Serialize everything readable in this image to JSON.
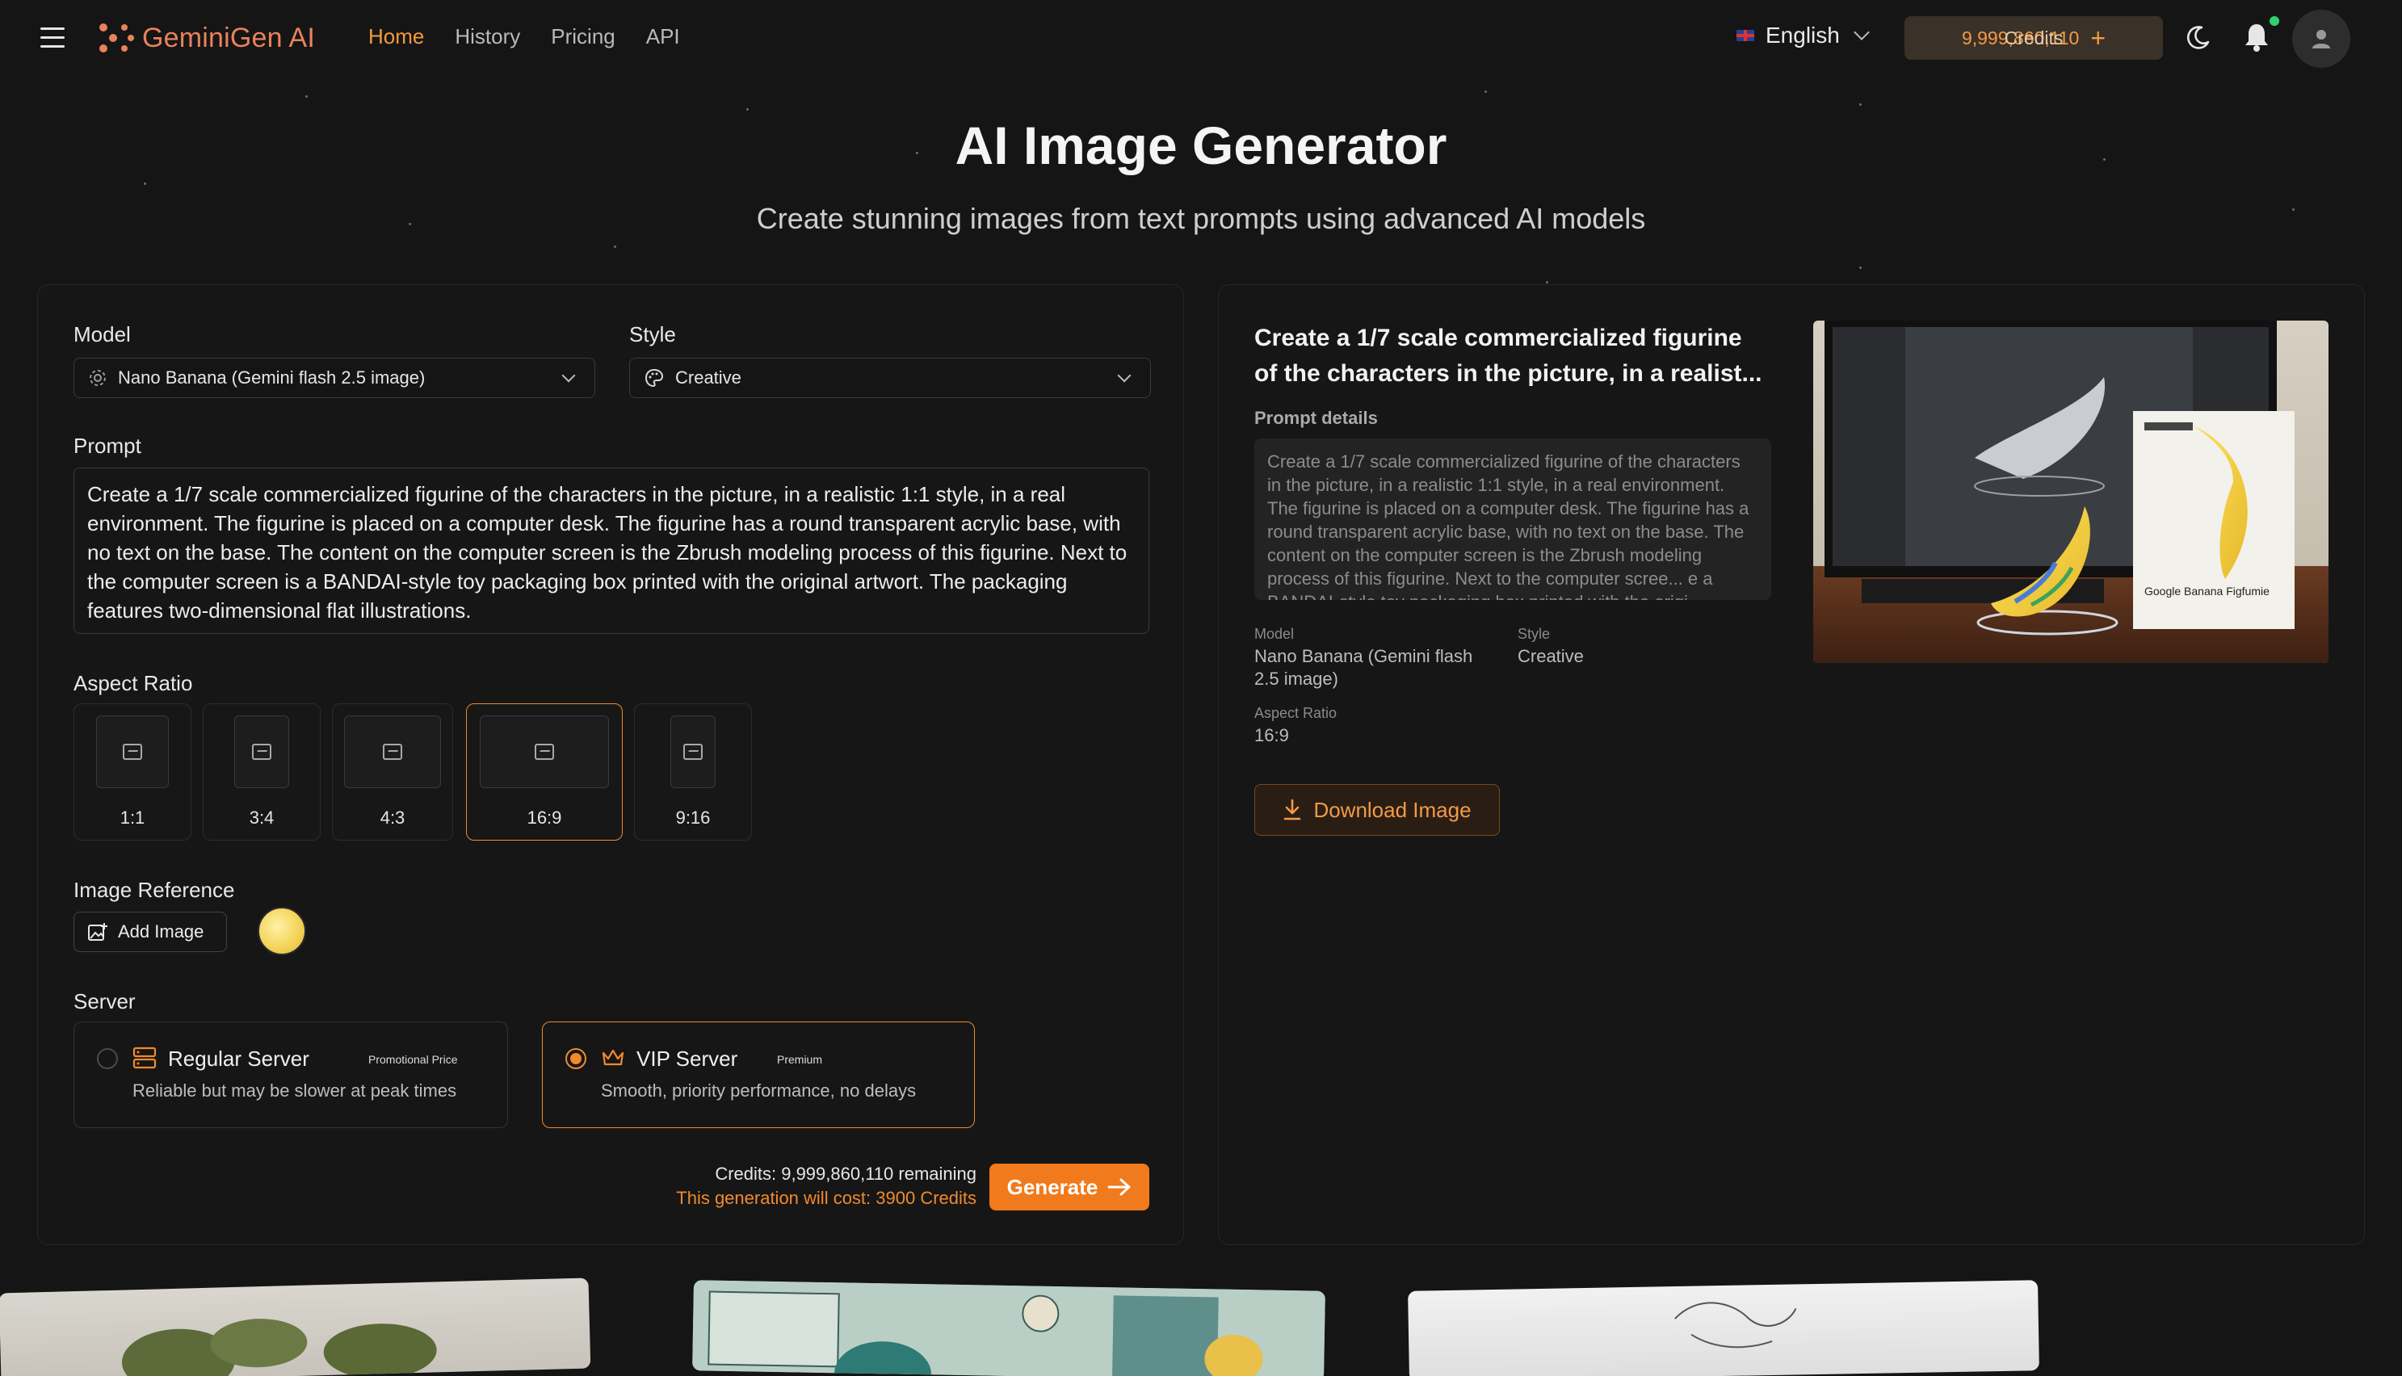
{
  "header": {
    "brand": "GeminiGen AI",
    "nav": [
      {
        "label": "Home",
        "active": true
      },
      {
        "label": "History",
        "active": false
      },
      {
        "label": "Pricing",
        "active": false
      },
      {
        "label": "API",
        "active": false
      }
    ],
    "language": "English",
    "credits": "9,999,860,110",
    "credits_label": "Credits",
    "accent": "#f59a3c"
  },
  "hero": {
    "title": "AI Image Generator",
    "subtitle": "Create stunning images from text prompts using advanced AI models"
  },
  "form": {
    "model_label": "Model",
    "model_value": "Nano Banana (Gemini flash 2.5 image)",
    "style_label": "Style",
    "style_value": "Creative",
    "prompt_label": "Prompt",
    "prompt_value": "Create a 1/7 scale commercialized figurine of the characters in the picture, in a realistic 1:1 style, in a real environment. The figurine is placed on a computer desk. The figurine has a round transparent acrylic base, with no text on the base. The content on the computer screen is the Zbrush modeling process of this figurine. Next to the computer screen is a BANDAI-style toy packaging box printed with the original artwort. The packaging features two-dimensional flat illustrations.",
    "aspect_label": "Aspect Ratio",
    "aspect_ratios": [
      "1:1",
      "3:4",
      "4:3",
      "16:9",
      "9:16"
    ],
    "aspect_selected": "16:9",
    "image_ref_label": "Image Reference",
    "add_image_label": "Add Image",
    "server_label": "Server",
    "servers": [
      {
        "title": "Regular Server",
        "badge": "Promotional Price",
        "desc": "Reliable but may be slower at peak times",
        "selected": false
      },
      {
        "title": "VIP Server",
        "badge": "Premium",
        "desc": "Smooth, priority performance, no delays",
        "selected": true
      }
    ],
    "credits_remaining": "Credits: 9,999,860,110 remaining",
    "cost_text": "This generation will cost: 3900 Credits",
    "generate_label": "Generate"
  },
  "result": {
    "title": "Create a 1/7 scale commercialized figurine of the characters in the picture, in a realist...",
    "prompt_details_label": "Prompt details",
    "prompt_text": "Create a 1/7 scale commercialized figurine of the characters in the picture, in a realistic 1:1 style, in a real environment. The figurine is placed on a computer desk. The figurine has a round transparent acrylic base, with no text on the base. The content on the computer screen is the Zbrush modeling process of this figurine. Next to the computer scree... e a BANDAI-style toy packaging box printed with the origi...",
    "model_key": "Model",
    "model_val": "Nano Banana (Gemini flash 2.5 image)",
    "style_key": "Style",
    "style_val": "Creative",
    "aspect_key": "Aspect Ratio",
    "aspect_val": "16:9",
    "download_label": "Download Image",
    "box_label": "Google Banana Figfumie"
  }
}
